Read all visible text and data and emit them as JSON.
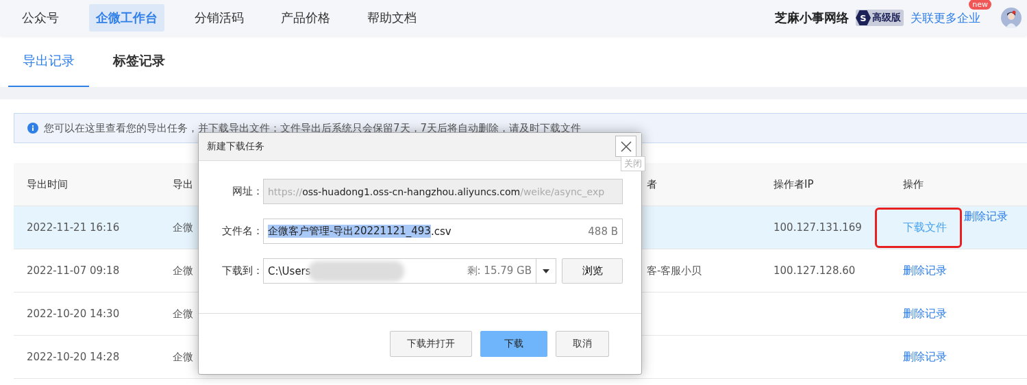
{
  "nav": {
    "items": [
      {
        "label": "公众号",
        "selected": false
      },
      {
        "label": "企微工作台",
        "selected": true
      },
      {
        "label": "分销活码",
        "selected": false
      },
      {
        "label": "产品价格",
        "selected": false
      },
      {
        "label": "帮助文档",
        "selected": false
      }
    ],
    "company": "芝麻小事网络",
    "plan_letter": "S",
    "plan": "高级版",
    "link": "关联更多企业",
    "new_badge": "new"
  },
  "tabs": [
    {
      "label": "导出记录",
      "selected": true
    },
    {
      "label": "标签记录",
      "selected": false
    }
  ],
  "notice": "您可以在这里查看您的导出任务，并下载导出文件；文件导出后系统只会保留7天，7天后将自动删除，请及时下载文件",
  "table": {
    "columns": [
      "导出时间",
      "导出",
      "",
      "者",
      "操作者IP",
      "操作"
    ],
    "rows": [
      {
        "selected": true,
        "cells": [
          "2022-11-21 16:16",
          "企微",
          "",
          "",
          "100.127.131.169"
        ],
        "actions": [
          {
            "label": "下载文件",
            "kind": "download",
            "highlighted": true
          },
          {
            "label": "删除记录",
            "kind": "delete",
            "highlighted": false
          }
        ]
      },
      {
        "selected": false,
        "cells": [
          "2022-11-07 09:18",
          "企微",
          "",
          "客-客服小贝",
          "100.127.128.60"
        ],
        "actions": [
          {
            "label": "删除记录",
            "kind": "delete",
            "highlighted": false
          }
        ]
      },
      {
        "selected": false,
        "cells": [
          "2022-10-20 14:30",
          "企微",
          "",
          "",
          ""
        ],
        "actions": [
          {
            "label": "删除记录",
            "kind": "delete",
            "highlighted": false
          }
        ]
      },
      {
        "selected": false,
        "cells": [
          "2022-10-20 14:28",
          "企微",
          "",
          "",
          ""
        ],
        "actions": [
          {
            "label": "删除记录",
            "kind": "delete",
            "highlighted": false
          }
        ]
      }
    ]
  },
  "dialog": {
    "title": "新建下载任务",
    "close_tooltip": "关闭",
    "url_label": "网址：",
    "url": {
      "prefix": "https://",
      "host": "oss-huadong1.oss-cn-hangzhou.aliyuncs.com",
      "path": "/weike/async_exp"
    },
    "filename_label": "文件名：",
    "filename_selected": "企微客户管理-导出20221121_493",
    "filename_rest": ".csv",
    "size": "488 B",
    "saveto_label": "下载到：",
    "path": "C:\\Users",
    "free": "剩: 15.79 GB",
    "browse": "浏览",
    "buttons": [
      {
        "label": "下载并打开",
        "primary": false
      },
      {
        "label": "下载",
        "primary": true
      },
      {
        "label": "取消",
        "primary": false
      }
    ]
  }
}
